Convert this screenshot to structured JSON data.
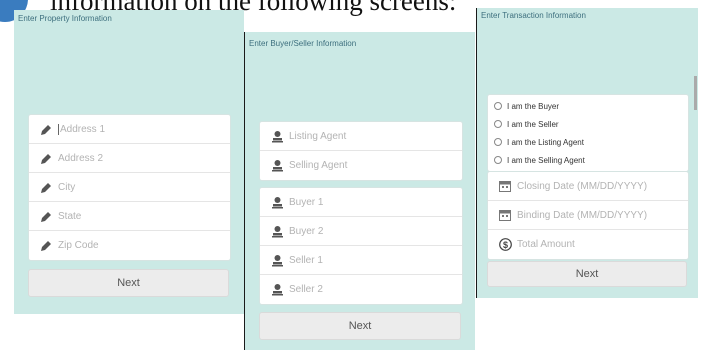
{
  "doc": {
    "text": "information on the following screens:"
  },
  "screen1": {
    "title": "Enter Property Information",
    "fields": [
      "Address 1",
      "Address 2",
      "City",
      "State",
      "Zip Code"
    ],
    "next": "Next"
  },
  "screen2": {
    "title": "Enter Buyer/Seller Information",
    "agents": [
      "Listing Agent",
      "Selling Agent"
    ],
    "parties": [
      "Buyer 1",
      "Buyer 2",
      "Seller 1",
      "Seller 2"
    ],
    "next": "Next"
  },
  "screen3": {
    "title": "Enter Transaction Information",
    "roles": [
      "I am the Buyer",
      "I am the Seller",
      "I am the Listing Agent",
      "I am the Selling Agent"
    ],
    "dates": [
      "Closing Date (MM/DD/YYYY)",
      "Binding Date (MM/DD/YYYY)"
    ],
    "amount": "Total Amount",
    "next": "Next"
  },
  "colors": {
    "screen_bg": "#cbe9e5",
    "title": "#3d6f7e",
    "placeholder": "#b3b3b3"
  },
  "icons": {
    "field": "pencil-icon",
    "person": "person-icon",
    "calendar": "calendar-icon",
    "dollar": "dollar-icon"
  }
}
